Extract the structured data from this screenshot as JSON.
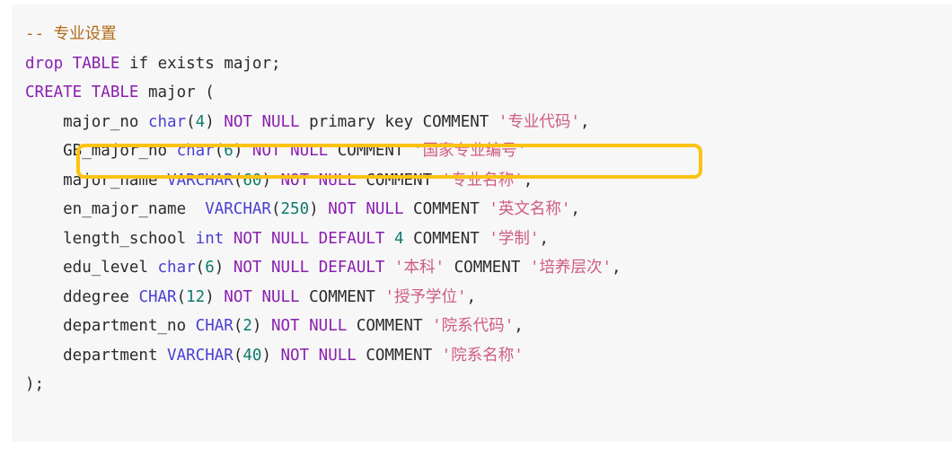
{
  "editor": {
    "language": "sql",
    "background_color": "#f7f7f7",
    "page_background_color": "#ffffff"
  },
  "highlight": {
    "name": "annotation-box",
    "color": "#fdc212",
    "target_line_index": 4,
    "label": "GB_major_no char(6) NOT NULL COMMENT '国家专业编号'"
  },
  "colors": {
    "comment": "#b06a17",
    "keyword": "#8a1fb0",
    "type": "#4a3fd0",
    "number": "#0f7a6c",
    "string": "#cf5b84",
    "plain": "#2b2b2b"
  },
  "code": {
    "lines": [
      {
        "index": 0,
        "text": "-- 专业设置",
        "tokens": [
          {
            "t": "-- 专业设置",
            "c": "tok-comment"
          }
        ]
      },
      {
        "index": 1,
        "text": "drop TABLE if exists major;",
        "tokens": [
          {
            "t": "drop",
            "c": "tok-kw"
          },
          {
            "t": " ",
            "c": "tok-plain"
          },
          {
            "t": "TABLE",
            "c": "tok-kw"
          },
          {
            "t": " ",
            "c": "tok-plain"
          },
          {
            "t": "if",
            "c": "tok-plain"
          },
          {
            "t": " ",
            "c": "tok-plain"
          },
          {
            "t": "exists",
            "c": "tok-plain"
          },
          {
            "t": " major;",
            "c": "tok-plain"
          }
        ]
      },
      {
        "index": 2,
        "text": "CREATE TABLE major (",
        "tokens": [
          {
            "t": "CREATE",
            "c": "tok-kw"
          },
          {
            "t": " ",
            "c": "tok-plain"
          },
          {
            "t": "TABLE",
            "c": "tok-kw"
          },
          {
            "t": " major (",
            "c": "tok-plain"
          }
        ]
      },
      {
        "index": 3,
        "text": "    major_no char(4) NOT NULL primary key COMMENT '专业代码',",
        "tokens": [
          {
            "t": "    major_no ",
            "c": "tok-plain"
          },
          {
            "t": "char",
            "c": "tok-type"
          },
          {
            "t": "(",
            "c": "tok-plain"
          },
          {
            "t": "4",
            "c": "tok-num"
          },
          {
            "t": ") ",
            "c": "tok-plain"
          },
          {
            "t": "NOT",
            "c": "tok-kw"
          },
          {
            "t": " ",
            "c": "tok-plain"
          },
          {
            "t": "NULL",
            "c": "tok-kw"
          },
          {
            "t": " primary key COMMENT ",
            "c": "tok-plain"
          },
          {
            "t": "'专业代码'",
            "c": "tok-str"
          },
          {
            "t": ",",
            "c": "tok-plain"
          }
        ]
      },
      {
        "index": 4,
        "text": "    GB_major_no char(6) NOT NULL COMMENT '国家专业编号'",
        "tokens": [
          {
            "t": "    GB_major_no ",
            "c": "tok-plain"
          },
          {
            "t": "char",
            "c": "tok-type"
          },
          {
            "t": "(",
            "c": "tok-plain"
          },
          {
            "t": "6",
            "c": "tok-num"
          },
          {
            "t": ") ",
            "c": "tok-plain"
          },
          {
            "t": "NOT",
            "c": "tok-kw"
          },
          {
            "t": " ",
            "c": "tok-plain"
          },
          {
            "t": "NULL",
            "c": "tok-kw"
          },
          {
            "t": " COMMENT ",
            "c": "tok-plain"
          },
          {
            "t": "'国家专业编号'",
            "c": "tok-str"
          }
        ]
      },
      {
        "index": 5,
        "text": "    major_name VARCHAR(60) NOT NULL COMMENT '专业名称',",
        "tokens": [
          {
            "t": "    major_name ",
            "c": "tok-plain"
          },
          {
            "t": "VARCHAR",
            "c": "tok-type"
          },
          {
            "t": "(",
            "c": "tok-plain"
          },
          {
            "t": "60",
            "c": "tok-num"
          },
          {
            "t": ") ",
            "c": "tok-plain"
          },
          {
            "t": "NOT",
            "c": "tok-kw"
          },
          {
            "t": " ",
            "c": "tok-plain"
          },
          {
            "t": "NULL",
            "c": "tok-kw"
          },
          {
            "t": " COMMENT ",
            "c": "tok-plain"
          },
          {
            "t": "'专业名称'",
            "c": "tok-str"
          },
          {
            "t": ",",
            "c": "tok-plain"
          }
        ]
      },
      {
        "index": 6,
        "text": "    en_major_name  VARCHAR(250) NOT NULL COMMENT '英文名称',",
        "tokens": [
          {
            "t": "    en_major_name  ",
            "c": "tok-plain"
          },
          {
            "t": "VARCHAR",
            "c": "tok-type"
          },
          {
            "t": "(",
            "c": "tok-plain"
          },
          {
            "t": "250",
            "c": "tok-num"
          },
          {
            "t": ") ",
            "c": "tok-plain"
          },
          {
            "t": "NOT",
            "c": "tok-kw"
          },
          {
            "t": " ",
            "c": "tok-plain"
          },
          {
            "t": "NULL",
            "c": "tok-kw"
          },
          {
            "t": " COMMENT ",
            "c": "tok-plain"
          },
          {
            "t": "'英文名称'",
            "c": "tok-str"
          },
          {
            "t": ",",
            "c": "tok-plain"
          }
        ]
      },
      {
        "index": 7,
        "text": "    length_school int NOT NULL DEFAULT 4 COMMENT '学制',",
        "tokens": [
          {
            "t": "    length_school ",
            "c": "tok-plain"
          },
          {
            "t": "int",
            "c": "tok-type"
          },
          {
            "t": " ",
            "c": "tok-plain"
          },
          {
            "t": "NOT",
            "c": "tok-kw"
          },
          {
            "t": " ",
            "c": "tok-plain"
          },
          {
            "t": "NULL",
            "c": "tok-kw"
          },
          {
            "t": " ",
            "c": "tok-plain"
          },
          {
            "t": "DEFAULT",
            "c": "tok-kw"
          },
          {
            "t": " ",
            "c": "tok-plain"
          },
          {
            "t": "4",
            "c": "tok-num"
          },
          {
            "t": " COMMENT ",
            "c": "tok-plain"
          },
          {
            "t": "'学制'",
            "c": "tok-str"
          },
          {
            "t": ",",
            "c": "tok-plain"
          }
        ]
      },
      {
        "index": 8,
        "text": "    edu_level char(6) NOT NULL DEFAULT '本科' COMMENT '培养层次',",
        "tokens": [
          {
            "t": "    edu_level ",
            "c": "tok-plain"
          },
          {
            "t": "char",
            "c": "tok-type"
          },
          {
            "t": "(",
            "c": "tok-plain"
          },
          {
            "t": "6",
            "c": "tok-num"
          },
          {
            "t": ") ",
            "c": "tok-plain"
          },
          {
            "t": "NOT",
            "c": "tok-kw"
          },
          {
            "t": " ",
            "c": "tok-plain"
          },
          {
            "t": "NULL",
            "c": "tok-kw"
          },
          {
            "t": " ",
            "c": "tok-plain"
          },
          {
            "t": "DEFAULT",
            "c": "tok-kw"
          },
          {
            "t": " ",
            "c": "tok-plain"
          },
          {
            "t": "'本科'",
            "c": "tok-str"
          },
          {
            "t": " COMMENT ",
            "c": "tok-plain"
          },
          {
            "t": "'培养层次'",
            "c": "tok-str"
          },
          {
            "t": ",",
            "c": "tok-plain"
          }
        ]
      },
      {
        "index": 9,
        "text": "    ddegree CHAR(12) NOT NULL COMMENT '授予学位',",
        "tokens": [
          {
            "t": "    ddegree ",
            "c": "tok-plain"
          },
          {
            "t": "CHAR",
            "c": "tok-type"
          },
          {
            "t": "(",
            "c": "tok-plain"
          },
          {
            "t": "12",
            "c": "tok-num"
          },
          {
            "t": ") ",
            "c": "tok-plain"
          },
          {
            "t": "NOT",
            "c": "tok-kw"
          },
          {
            "t": " ",
            "c": "tok-plain"
          },
          {
            "t": "NULL",
            "c": "tok-kw"
          },
          {
            "t": " COMMENT ",
            "c": "tok-plain"
          },
          {
            "t": "'授予学位'",
            "c": "tok-str"
          },
          {
            "t": ",",
            "c": "tok-plain"
          }
        ]
      },
      {
        "index": 10,
        "text": "    department_no CHAR(2) NOT NULL COMMENT '院系代码',",
        "tokens": [
          {
            "t": "    department_no ",
            "c": "tok-plain"
          },
          {
            "t": "CHAR",
            "c": "tok-type"
          },
          {
            "t": "(",
            "c": "tok-plain"
          },
          {
            "t": "2",
            "c": "tok-num"
          },
          {
            "t": ") ",
            "c": "tok-plain"
          },
          {
            "t": "NOT",
            "c": "tok-kw"
          },
          {
            "t": " ",
            "c": "tok-plain"
          },
          {
            "t": "NULL",
            "c": "tok-kw"
          },
          {
            "t": " COMMENT ",
            "c": "tok-plain"
          },
          {
            "t": "'院系代码'",
            "c": "tok-str"
          },
          {
            "t": ",",
            "c": "tok-plain"
          }
        ]
      },
      {
        "index": 11,
        "text": "    department VARCHAR(40) NOT NULL COMMENT '院系名称'",
        "tokens": [
          {
            "t": "    department ",
            "c": "tok-plain"
          },
          {
            "t": "VARCHAR",
            "c": "tok-type"
          },
          {
            "t": "(",
            "c": "tok-plain"
          },
          {
            "t": "40",
            "c": "tok-num"
          },
          {
            "t": ") ",
            "c": "tok-plain"
          },
          {
            "t": "NOT",
            "c": "tok-kw"
          },
          {
            "t": " ",
            "c": "tok-plain"
          },
          {
            "t": "NULL",
            "c": "tok-kw"
          },
          {
            "t": " COMMENT ",
            "c": "tok-plain"
          },
          {
            "t": "'院系名称'",
            "c": "tok-str"
          }
        ]
      },
      {
        "index": 12,
        "text": ");",
        "tokens": [
          {
            "t": ");",
            "c": "tok-plain"
          }
        ]
      }
    ]
  }
}
